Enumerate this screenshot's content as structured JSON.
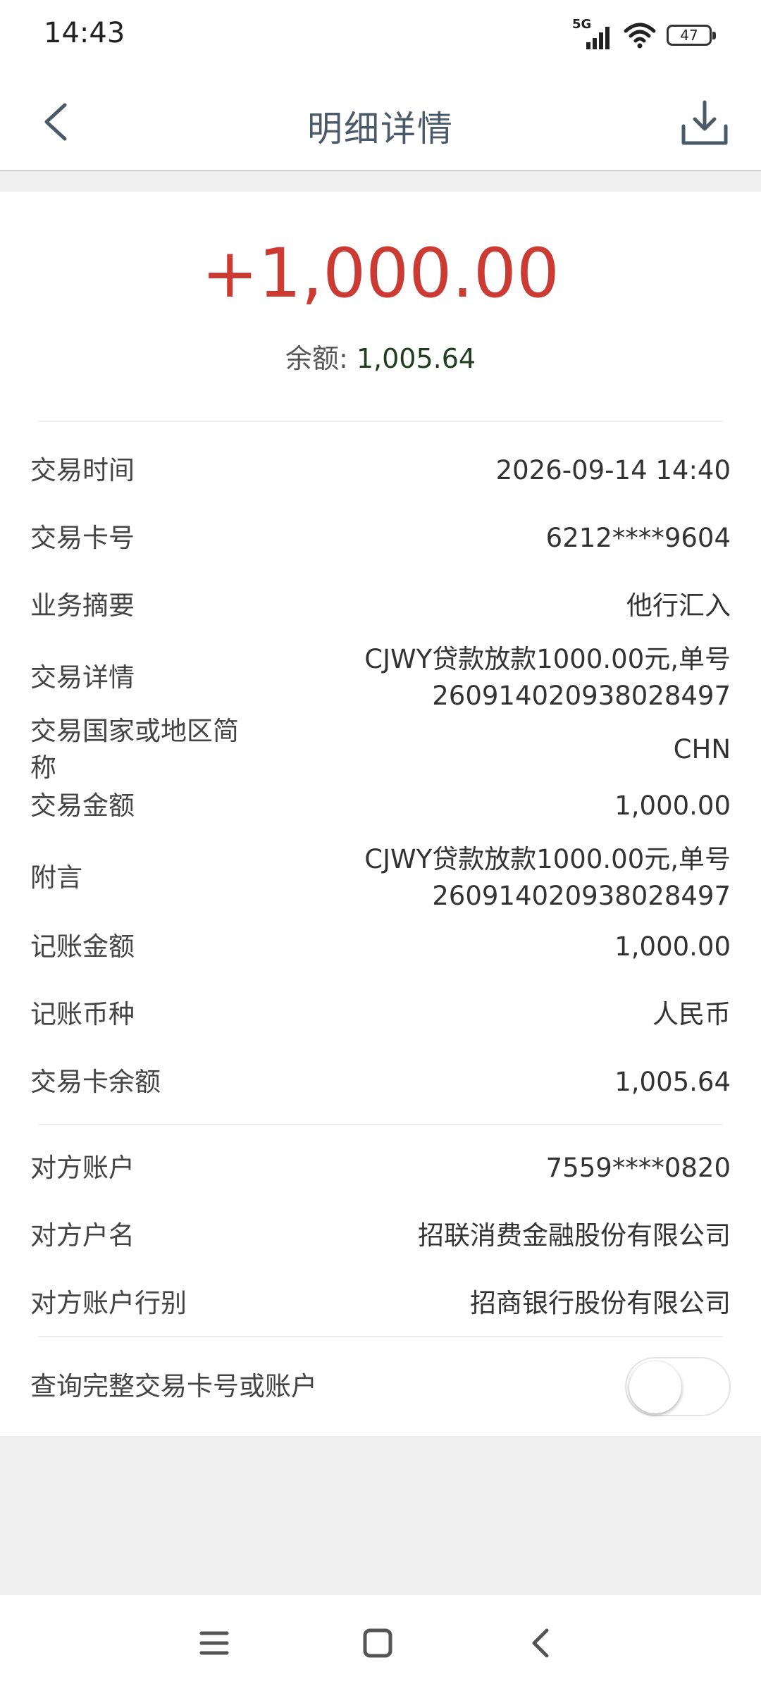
{
  "status_bar": {
    "time": "14:43",
    "network": "5G",
    "battery": "47",
    "icons": [
      "signal-icon",
      "wifi-icon",
      "battery-icon"
    ]
  },
  "nav": {
    "title": "明细详情",
    "back_icon": "chevron-left-icon",
    "download_icon": "download-icon"
  },
  "summary": {
    "amount": "+1,000.00",
    "balance_label": "余额:",
    "balance_value": "1,005.64",
    "amount_color": "#cc3a34"
  },
  "details": [
    {
      "label": "交易时间",
      "value": [
        "2026-09-14 14:40"
      ]
    },
    {
      "label": "交易卡号",
      "value": [
        "6212****9604"
      ]
    },
    {
      "label": "业务摘要",
      "value": [
        "他行汇入"
      ]
    },
    {
      "label": "交易详情",
      "value": [
        "CJWY贷款放款1000.00元,单号",
        "260914020938028497"
      ]
    },
    {
      "label": "交易国家或地区简称",
      "value": [
        "CHN"
      ]
    },
    {
      "label": "交易金额",
      "value": [
        "1,000.00"
      ]
    },
    {
      "label": "附言",
      "value": [
        "CJWY贷款放款1000.00元,单号",
        "260914020938028497"
      ]
    },
    {
      "label": "记账金额",
      "value": [
        "1,000.00"
      ]
    },
    {
      "label": "记账币种",
      "value": [
        "人民币"
      ]
    },
    {
      "label": "交易卡余额",
      "value": [
        "1,005.64"
      ]
    }
  ],
  "counterparty": [
    {
      "label": "对方账户",
      "value": [
        "7559****0820"
      ]
    },
    {
      "label": "对方户名",
      "value": [
        "招联消费金融股份有限公司"
      ]
    },
    {
      "label": "对方账户行别",
      "value": [
        "招商银行股份有限公司"
      ]
    }
  ],
  "toggle_row": {
    "label": "查询完整交易卡号或账户",
    "state": "off"
  },
  "system_nav": [
    "menu-icon",
    "home-icon",
    "back-icon"
  ]
}
